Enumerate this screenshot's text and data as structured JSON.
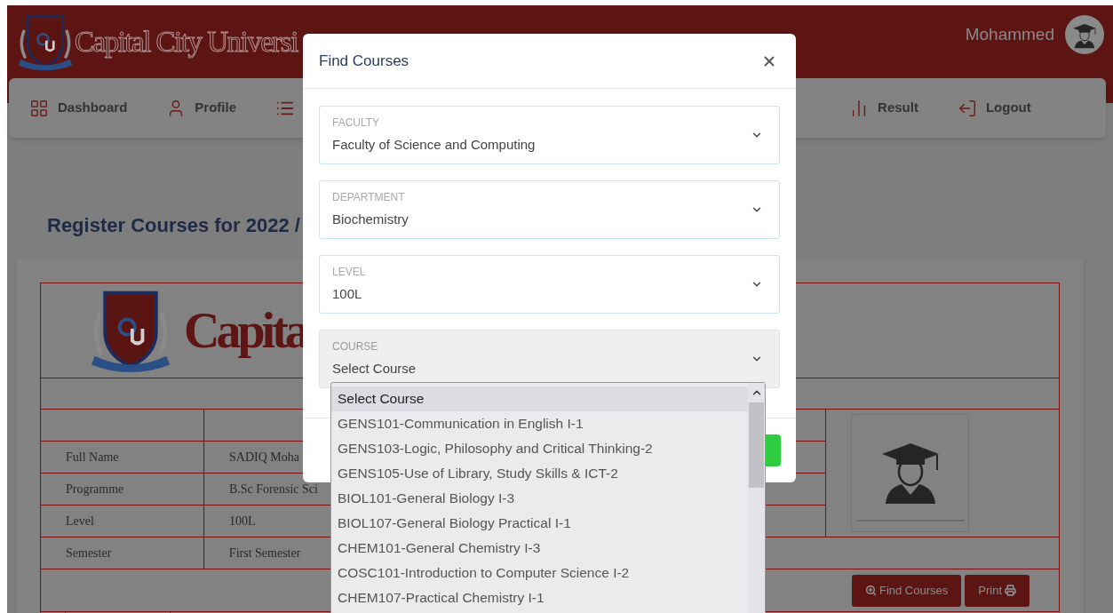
{
  "header": {
    "brand": "Capital City Universi",
    "user_name": "Mohammed"
  },
  "nav": [
    {
      "kind": "dashboard",
      "label": "Dashboard"
    },
    {
      "kind": "profile",
      "label": "Profile"
    },
    {
      "kind": "list"
    },
    {
      "kind": "result",
      "label": "Result"
    },
    {
      "kind": "logout",
      "label": "Logout"
    }
  ],
  "page": {
    "title": "Register Courses for 2022 /",
    "logo_text": "Capita",
    "student": [
      {
        "label": "Full Name",
        "value": "SADIQ Moha"
      },
      {
        "label": "Programme",
        "value": "B.Sc Forensic Sci"
      },
      {
        "label": "Level",
        "value": "100L"
      },
      {
        "label": "Semester",
        "value": "First Semester"
      }
    ],
    "buttons": [
      {
        "kind": "find",
        "label": "Find Courses"
      },
      {
        "kind": "print",
        "label": "Print"
      }
    ]
  },
  "modal": {
    "title": "Find Courses",
    "fields": [
      {
        "label": "FACULTY",
        "value": "Faculty of Science and Computing",
        "disabled": false
      },
      {
        "label": "DEPARTMENT",
        "value": "Biochemistry",
        "disabled": false
      },
      {
        "label": "LEVEL",
        "value": "100L",
        "disabled": false
      },
      {
        "label": "COURSE",
        "value": "Select Course",
        "disabled": true
      }
    ]
  },
  "dropdown": {
    "options": [
      {
        "label": "Select Course",
        "selected": true
      },
      {
        "label": "GENS101-Communication in English I-1",
        "selected": false
      },
      {
        "label": "GENS103-Logic, Philosophy and Critical Thinking-2",
        "selected": false
      },
      {
        "label": "GENS105-Use of Library, Study Skills & ICT-2",
        "selected": false
      },
      {
        "label": "BIOL101-General Biology I-3",
        "selected": false
      },
      {
        "label": "BIOL107-General Biology Practical I-1",
        "selected": false
      },
      {
        "label": "CHEM101-General Chemistry I-3",
        "selected": false
      },
      {
        "label": "COSC101-Introduction to Computer Science I-2",
        "selected": false
      },
      {
        "label": "CHEM107-Practical Chemistry I-1",
        "selected": false
      }
    ]
  }
}
